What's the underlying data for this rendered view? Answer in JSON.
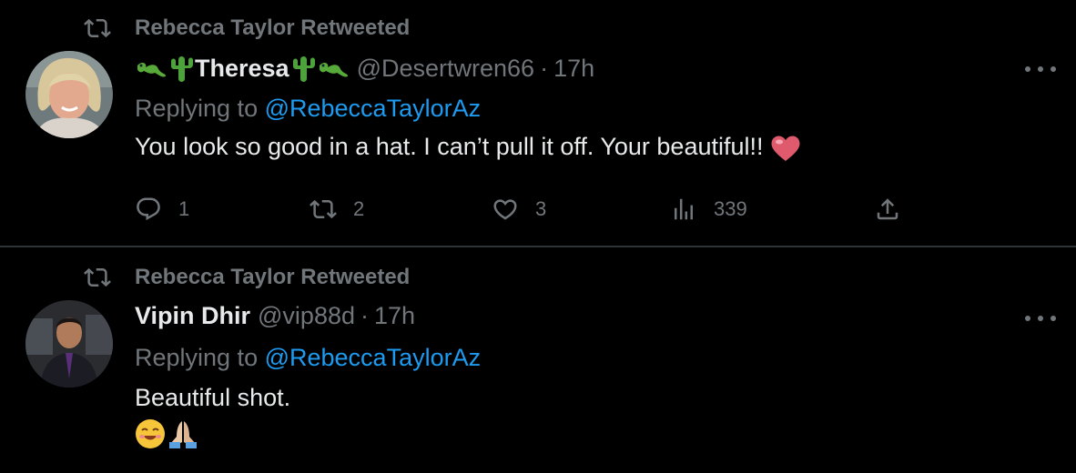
{
  "tweets": [
    {
      "retweet_label": "Rebecca Taylor Retweeted",
      "name": "Theresa",
      "handle": "@Desertwren66",
      "time": "17h",
      "replying_prefix": "Replying to ",
      "replying_to": "@RebeccaTaylorAz",
      "text": "You look so good in a hat.  I can’t pull it off.  Your beautiful!!",
      "replies": "1",
      "retweets": "2",
      "likes": "3",
      "views": "339",
      "icons": [
        "lizard-emoji",
        "cactus-emoji",
        "heart-emoji"
      ]
    },
    {
      "retweet_label": "Rebecca Taylor Retweeted",
      "name": "Vipin Dhir",
      "handle": "@vip88d",
      "time": "17h",
      "replying_prefix": "Replying to ",
      "replying_to": "@RebeccaTaylorAz",
      "text": "Beautiful shot.",
      "icons": [
        "smiling-face-emoji",
        "folded-hands-emoji"
      ]
    }
  ],
  "dot_separator": "·",
  "colors": {
    "background": "#000000",
    "text": "#e7e9ea",
    "muted": "#71767b",
    "link": "#1d9bf0",
    "divider": "#2f3336"
  }
}
